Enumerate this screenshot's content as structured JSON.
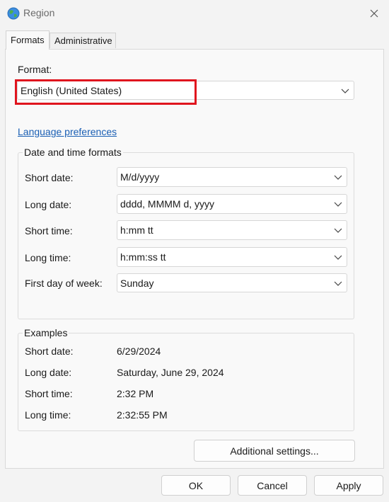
{
  "window": {
    "title": "Region",
    "close_icon": "close-icon",
    "app_icon": "globe-icon"
  },
  "tabs": [
    {
      "label": "Formats",
      "active": true
    },
    {
      "label": "Administrative",
      "active": false
    }
  ],
  "format": {
    "label": "Format:",
    "value": "English (United States)"
  },
  "language_link": "Language preferences",
  "date_time_formats": {
    "title": "Date and time formats",
    "rows": [
      {
        "label": "Short date:",
        "value": "M/d/yyyy"
      },
      {
        "label": "Long date:",
        "value": "dddd, MMMM d, yyyy"
      },
      {
        "label": "Short time:",
        "value": "h:mm tt"
      },
      {
        "label": "Long time:",
        "value": "h:mm:ss tt"
      },
      {
        "label": "First day of week:",
        "value": "Sunday"
      }
    ]
  },
  "examples": {
    "title": "Examples",
    "rows": [
      {
        "label": "Short date:",
        "value": "6/29/2024"
      },
      {
        "label": "Long date:",
        "value": "Saturday, June 29, 2024"
      },
      {
        "label": "Short time:",
        "value": "2:32 PM"
      },
      {
        "label": "Long time:",
        "value": "2:32:55 PM"
      }
    ]
  },
  "buttons": {
    "additional_settings": "Additional settings...",
    "ok": "OK",
    "cancel": "Cancel",
    "apply": "Apply"
  },
  "colors": {
    "highlight": "#e0151e",
    "link": "#1a5fb4"
  }
}
